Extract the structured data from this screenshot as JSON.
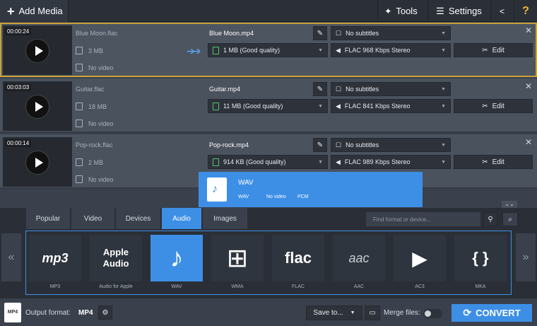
{
  "toolbar": {
    "add_media": "Add Media",
    "tools": "Tools",
    "settings": "Settings"
  },
  "files": [
    {
      "duration": "00:00:24",
      "source_name": "Blue Moon.flac",
      "source_size": "3 MB",
      "source_video": "No video",
      "output_name": "Blue Moon.mp4",
      "subtitles": "No subtitles",
      "output_size": "1 MB (Good quality)",
      "audio": "FLAC 968 Kbps Stereo",
      "edit": "Edit"
    },
    {
      "duration": "00:03:03",
      "source_name": "Guitar.flac",
      "source_size": "18 MB",
      "source_video": "No video",
      "output_name": "Guitar.mp4",
      "subtitles": "No subtitles",
      "output_size": "11 MB (Good quality)",
      "audio": "FLAC 841 Kbps Stereo",
      "edit": "Edit"
    },
    {
      "duration": "00:00:14",
      "source_name": "Pop-rock.flac",
      "source_size": "2 MB",
      "source_video": "No video",
      "output_name": "Pop-rock.mp4",
      "subtitles": "No subtitles",
      "output_size": "914 KB (Good quality)",
      "audio": "FLAC 989 Kbps Stereo",
      "edit": "Edit"
    }
  ],
  "tooltip": {
    "title": "WAV",
    "format": "WAV",
    "video": "No video",
    "codec": "PCM"
  },
  "tabs": [
    "Popular",
    "Video",
    "Devices",
    "Audio",
    "Images"
  ],
  "active_tab": "Audio",
  "search": {
    "placeholder": "Find format or device..."
  },
  "formats": [
    {
      "label": "MP3",
      "glyph": "mp3"
    },
    {
      "label": "Audio for Apple",
      "glyph": "Apple\nAudio"
    },
    {
      "label": "WAV",
      "glyph": "♪"
    },
    {
      "label": "WMA",
      "glyph": "⊞"
    },
    {
      "label": "FLAC",
      "glyph": "flac"
    },
    {
      "label": "AAC",
      "glyph": "aac"
    },
    {
      "label": "AC3",
      "glyph": "▶"
    },
    {
      "label": "MKA",
      "glyph": "{ }"
    }
  ],
  "active_format": "WAV",
  "bottom": {
    "output_label": "Output format:",
    "output_value": "MP4",
    "save_to": "Save to...",
    "merge_label": "Merge files:",
    "convert": "CONVERT",
    "mp4_icon": "MP4"
  },
  "colors": {
    "accent": "#3d8fe6",
    "selected_outline": "#c9a23a",
    "edit_green": "#56c46a"
  }
}
